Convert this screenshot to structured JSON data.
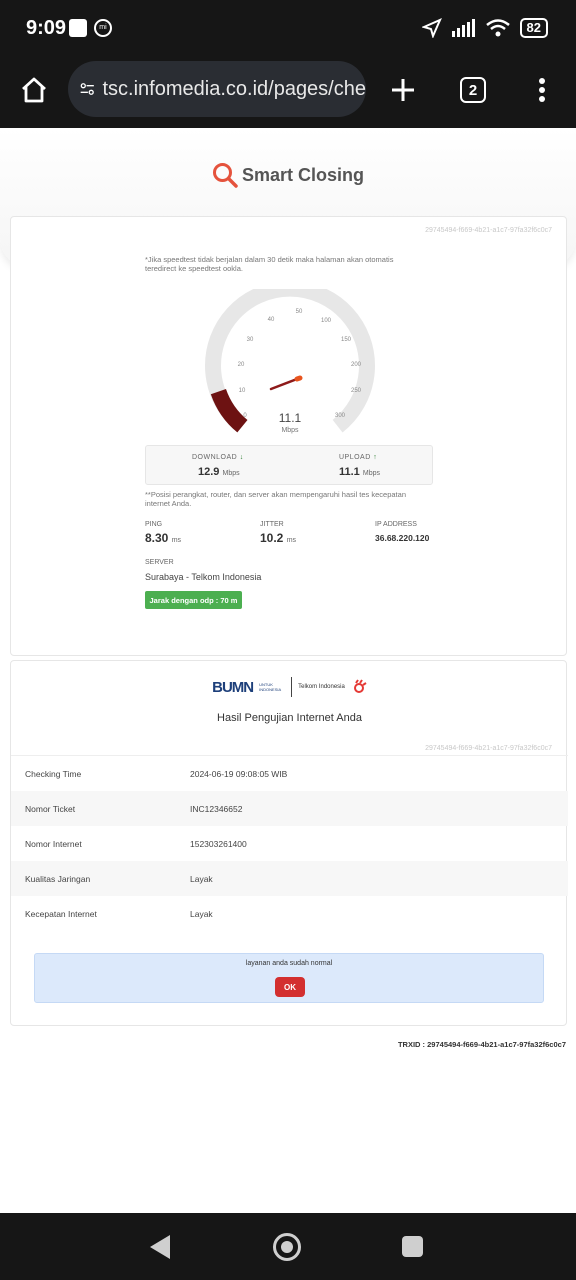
{
  "status_bar": {
    "time": "9:09",
    "battery": "82"
  },
  "browser": {
    "url": "tsc.infomedia.co.id/pages/che",
    "tab_count": "2"
  },
  "page": {
    "title": "Smart Closing",
    "trx_short": "29745494-f669-4b21-a1c7-97fa32f6c0c7",
    "note": "*Jika speedtest tidak berjalan dalam 30 detik maka halaman akan otomatis teredirect ke speedtest ookla.",
    "gauge": {
      "ticks": [
        "0",
        "10",
        "20",
        "30",
        "40",
        "50",
        "100",
        "150",
        "200",
        "250",
        "300"
      ],
      "value": "11.1",
      "unit": "Mbps"
    },
    "download": {
      "label": "DOWNLOAD",
      "value": "12.9",
      "unit": "Mbps"
    },
    "upload": {
      "label": "UPLOAD",
      "value": "11.1",
      "unit": "Mbps"
    },
    "note2": "**Posisi perangkat, router, dan server akan mempengaruhi hasil tes kecepatan internet Anda.",
    "ping": {
      "label": "PING",
      "value": "8.30",
      "unit": "ms"
    },
    "jitter": {
      "label": "JITTER",
      "value": "10.2",
      "unit": "ms"
    },
    "ip": {
      "label": "IP ADDRESS",
      "value": "36.68.220.120"
    },
    "server": {
      "label": "SERVER",
      "value": "Surabaya - Telkom Indonesia"
    },
    "odp_button": "Jarak dengan odp : 70 m"
  },
  "result": {
    "bumn": "BUMN",
    "bumn_sub": "UNTUK INDONESIA",
    "telkom": "Telkom Indonesia",
    "title": "Hasil Pengujian Internet Anda",
    "trx_short": "29745494-f669-4b21-a1c7-97fa32f6c0c7",
    "rows": [
      {
        "key": "Checking Time",
        "value": "2024-06-19 09:08:05 WIB"
      },
      {
        "key": "Nomor Ticket",
        "value": "INC12346652"
      },
      {
        "key": "Nomor Internet",
        "value": "152303261400"
      },
      {
        "key": "Kualitas Jaringan",
        "value": "Layak"
      },
      {
        "key": "Kecepatan Internet",
        "value": "Layak"
      }
    ],
    "alert_message": "layanan anda sudah normal",
    "ok_button": "OK",
    "trxid": "TRXID : 29745494-f669-4b21-a1c7-97fa32f6c0c7"
  }
}
